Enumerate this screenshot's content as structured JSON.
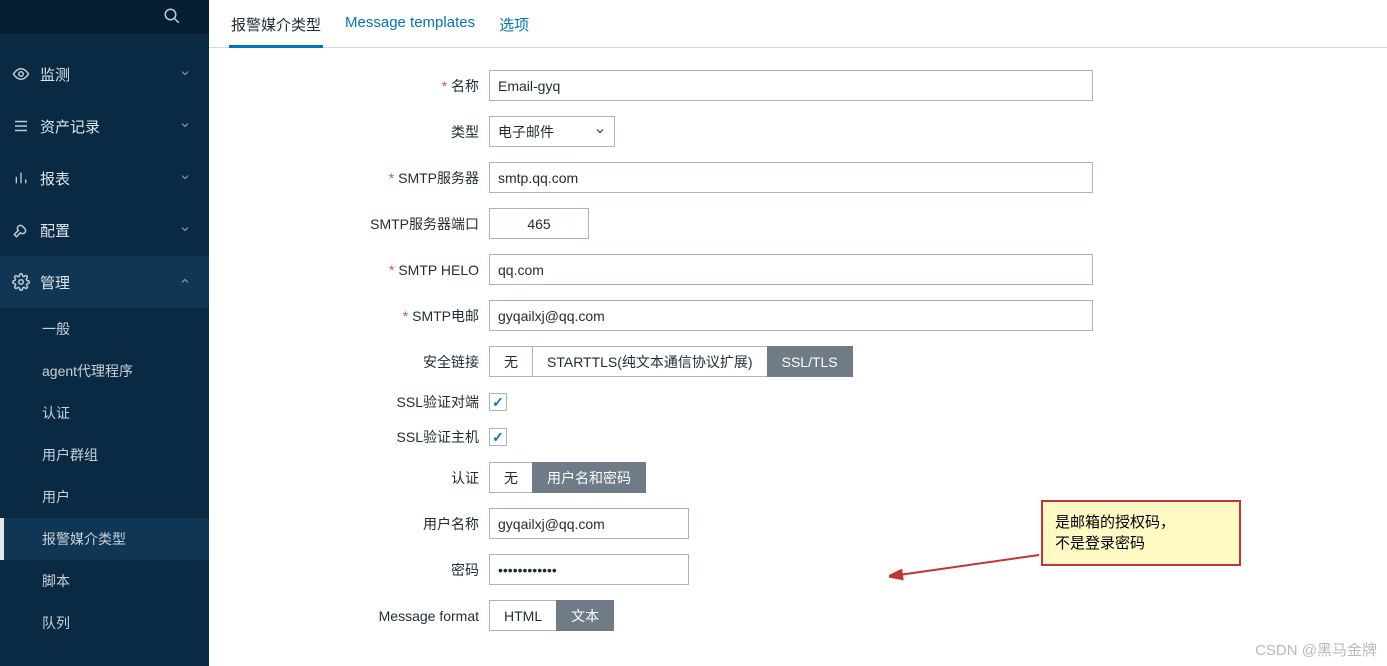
{
  "sidebar": {
    "top_items": [
      {
        "icon": "eye",
        "label": "监测"
      },
      {
        "icon": "list",
        "label": "资产记录"
      },
      {
        "icon": "bars",
        "label": "报表"
      },
      {
        "icon": "wrench",
        "label": "配置"
      },
      {
        "icon": "gear",
        "label": "管理"
      }
    ],
    "sub_items": [
      "一般",
      "agent代理程序",
      "认证",
      "用户群组",
      "用户",
      "报警媒介类型",
      "脚本",
      "队列"
    ],
    "active_sub": 5
  },
  "tabs": {
    "items": [
      "报警媒介类型",
      "Message templates",
      "选项"
    ],
    "active": 0
  },
  "form": {
    "name_label": "名称",
    "name_value": "Email-gyq",
    "type_label": "类型",
    "type_value": "电子邮件",
    "smtp_server_label": "SMTP服务器",
    "smtp_server_value": "smtp.qq.com",
    "smtp_port_label": "SMTP服务器端口",
    "smtp_port_value": "465",
    "smtp_helo_label": "SMTP HELO",
    "smtp_helo_value": "qq.com",
    "smtp_email_label": "SMTP电邮",
    "smtp_email_value": "gyqailxj@qq.com",
    "security_label": "安全链接",
    "security_options": [
      "无",
      "STARTTLS(纯文本通信协议扩展)",
      "SSL/TLS"
    ],
    "security_active": 2,
    "ssl_peer_label": "SSL验证对端",
    "ssl_host_label": "SSL验证主机",
    "auth_label": "认证",
    "auth_options": [
      "无",
      "用户名和密码"
    ],
    "auth_active": 1,
    "user_label": "用户名称",
    "user_value": "gyqailxj@qq.com",
    "password_label": "密码",
    "password_value": "••••••••••••",
    "msgfmt_label": "Message format",
    "msgfmt_options": [
      "HTML",
      "文本"
    ],
    "msgfmt_active": 1
  },
  "callout": {
    "line1": "是邮箱的授权码，",
    "line2": "不是登录密码"
  },
  "watermark": "CSDN @黑马金牌"
}
